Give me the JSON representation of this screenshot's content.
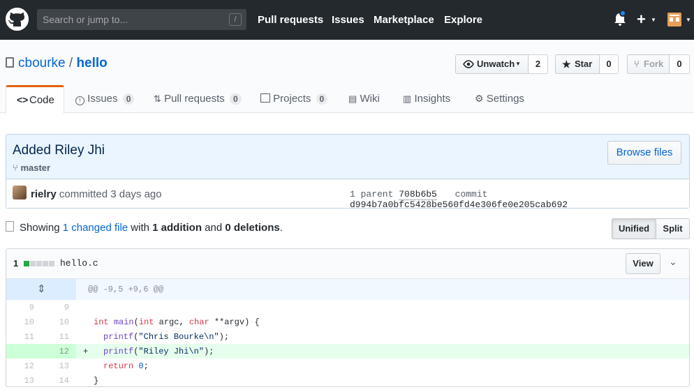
{
  "header": {
    "search_placeholder": "Search or jump to...",
    "search_shortcut": "/",
    "nav": [
      "Pull requests",
      "Issues",
      "Marketplace",
      "Explore"
    ]
  },
  "repo": {
    "owner": "cbourke",
    "separator": "/",
    "name": "hello",
    "unwatch_label": "Unwatch",
    "watch_count": "2",
    "star_label": "Star",
    "star_count": "0",
    "fork_label": "Fork",
    "fork_count": "0"
  },
  "tabs": [
    {
      "label": "Code"
    },
    {
      "label": "Issues",
      "count": "0"
    },
    {
      "label": "Pull requests",
      "count": "0"
    },
    {
      "label": "Projects",
      "count": "0"
    },
    {
      "label": "Wiki"
    },
    {
      "label": "Insights"
    },
    {
      "label": "Settings"
    }
  ],
  "commit": {
    "title": "Added Riley Jhi",
    "branch": "master",
    "browse_label": "Browse files",
    "author": "rielry",
    "action": "committed 3 days ago",
    "parent_label": "1 parent",
    "parent_sha": "708b6b5",
    "commit_label": "commit",
    "commit_sha": "d994b7a0bfc5428be560fd4e306fe0e205cab692"
  },
  "toc": {
    "showing": "Showing",
    "changed": "1 changed file",
    "with": "with",
    "additions": "1 addition",
    "and": "and",
    "deletions": "0 deletions",
    "period": ".",
    "unified_label": "Unified",
    "split_label": "Split"
  },
  "file": {
    "changes": "1",
    "name": "hello.c",
    "view_label": "View",
    "hunk_header": "@@ -9,5 +9,6 @@",
    "lines": [
      {
        "old": "9",
        "new": "9",
        "text": ""
      },
      {
        "old": "10",
        "new": "10",
        "text": "int main(int argc, char **argv) {"
      },
      {
        "old": "11",
        "new": "11",
        "text": "printf(\"Chris Bourke\\n\");"
      },
      {
        "old": "",
        "new": "12",
        "text": "printf(\"Riley Jhi\\n\");",
        "added": true
      },
      {
        "old": "12",
        "new": "13",
        "text": "return 0;"
      },
      {
        "old": "13",
        "new": "14",
        "text": "}"
      }
    ]
  },
  "colors": {
    "header_bg": "#24292e",
    "link": "#0366d6",
    "added_bg": "#e6ffed",
    "selected_tab_border": "#e36209"
  }
}
